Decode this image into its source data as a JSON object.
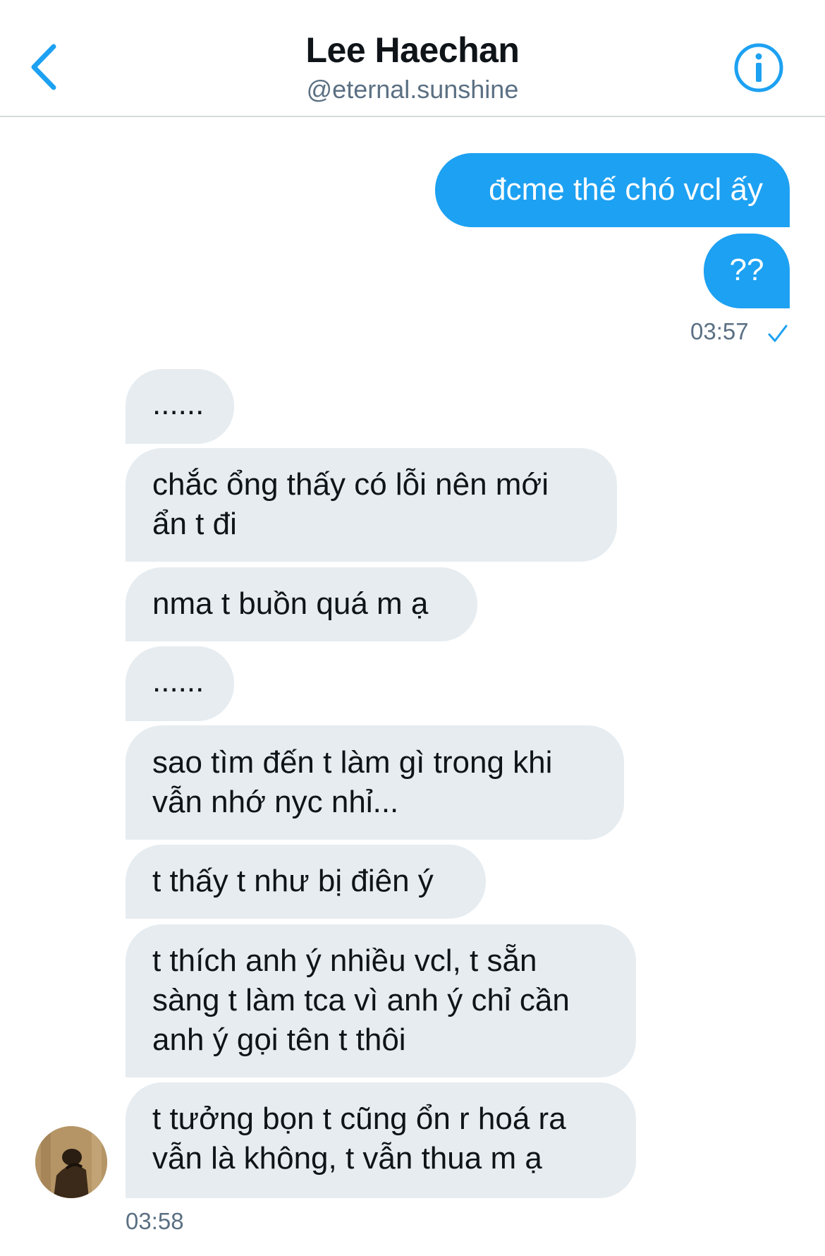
{
  "header": {
    "title": "Lee Haechan",
    "handle": "@eternal.sunshine"
  },
  "colors": {
    "accent": "#1da1f2",
    "incoming_bubble": "#e6ecf0",
    "muted_text": "#5b7083"
  },
  "icons": {
    "back": "chevron-left-icon",
    "info": "info-circle-icon",
    "read_receipt": "checkmark-icon"
  },
  "messages": {
    "outgoing": [
      "đcme thế chó vcl ấy",
      "??"
    ],
    "outgoing_time": "03:57",
    "incoming": [
      "......",
      "chắc ổng thấy có lỗi nên mới\nẩn t đi",
      "nma t buồn quá m ạ",
      "......",
      "sao tìm đến t làm gì trong khi\nvẫn nhớ nyc nhỉ...",
      "t thấy t như bị điên ý",
      "t thích anh ý nhiều vcl, t sẵn\nsàng t làm tca vì anh ý chỉ cần\nanh ý gọi tên t thôi",
      "t tưởng bọn t cũng ổn r hoá ra\nvẫn là không, t vẫn thua m ạ"
    ],
    "incoming_time": "03:58"
  }
}
